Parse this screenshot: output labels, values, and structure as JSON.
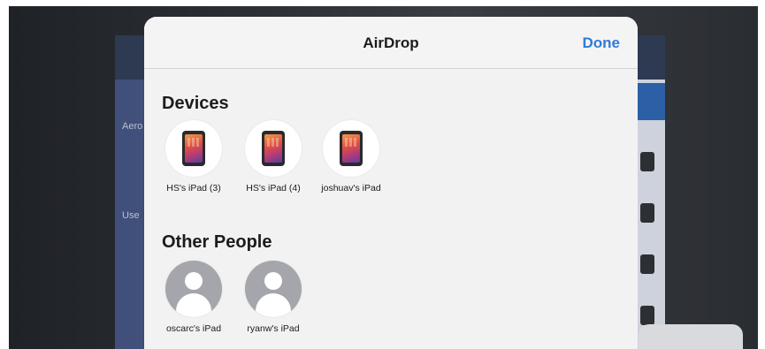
{
  "sheet": {
    "title": "AirDrop",
    "done_label": "Done"
  },
  "background": {
    "label_1": "Aero",
    "label_2": "Use"
  },
  "devices": {
    "section_title": "Devices",
    "items": [
      {
        "label": "HS's iPad (3)",
        "icon": "ipad-icon"
      },
      {
        "label": "HS's iPad (4)",
        "icon": "ipad-icon"
      },
      {
        "label": "joshuav's iPad",
        "icon": "ipad-icon"
      }
    ]
  },
  "other_people": {
    "section_title": "Other People",
    "items": [
      {
        "label": "oscarc's iPad",
        "icon": "person-avatar-icon"
      },
      {
        "label": "ryanw's iPad",
        "icon": "person-avatar-icon"
      }
    ]
  },
  "colors": {
    "accent": "#2f7bd6",
    "sheet_bg": "#f2f2f3"
  }
}
